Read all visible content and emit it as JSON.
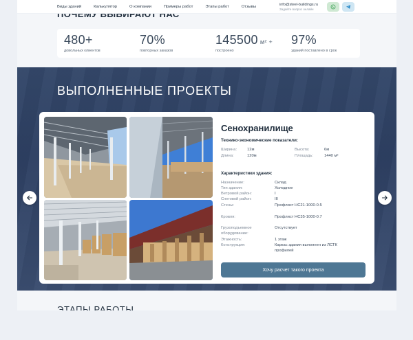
{
  "nav": {
    "items": [
      "Виды зданий",
      "Калькулятор",
      "О компании",
      "Примеры работ",
      "Этапы работ",
      "Отзывы"
    ],
    "email": "info@steel-buildings.ru",
    "email_hint": "Задайте вопрос онлайн",
    "whatsapp_icon": "whatsapp-icon",
    "telegram_icon": "telegram-icon"
  },
  "why": {
    "title": "Почему выбирают нас",
    "stats": [
      {
        "value": "480+",
        "unit": "",
        "label": "довольных клиентов"
      },
      {
        "value": "70%",
        "unit": "",
        "label": "повторных заказов"
      },
      {
        "value": "145500",
        "unit": "м² +",
        "label": "построено"
      },
      {
        "value": "97%",
        "unit": "",
        "label": "зданий поставлено в срок"
      }
    ]
  },
  "projects": {
    "title": "Выполненные проекты",
    "name": "Сенохранилище",
    "tech_heading": "Технико-экономические показатели:",
    "tech": [
      {
        "k": "Ширина:",
        "v": "12м"
      },
      {
        "k": "Длина:",
        "v": "120м"
      },
      {
        "k": "Высота:",
        "v": "6м"
      },
      {
        "k": "Площадь:",
        "v": "1440 м²"
      }
    ],
    "chars_heading": "Характеристики здания:",
    "chars": [
      {
        "k": "Назначение:",
        "v": "Склад"
      },
      {
        "k": "Тип здания:",
        "v": "Холодное"
      },
      {
        "k": "Ветровой район:",
        "v": "I"
      },
      {
        "k": "Снеговой район:",
        "v": "III"
      },
      {
        "k": "Стены:",
        "v": "Профлист НС21-1000-0.5"
      },
      {
        "k": "Кровля:",
        "v": "Профлист НС35-1000-0.7"
      },
      {
        "k": "Грузоподъемное",
        "k2": "оборудование:",
        "v": "Отсутствует"
      },
      {
        "k": "Этажность:",
        "v": "1 этаж"
      },
      {
        "k": "Конструкция:",
        "v": "Каркас здания выполнен из ЛСТК",
        "v2": "профилей"
      }
    ],
    "cta_label": "Хочу расчет такого проекта"
  },
  "stages": {
    "title": "Этапы работы"
  },
  "colors": {
    "accent": "#4e7794",
    "dark_bg": "#2e4063",
    "title_dark": "#1f2d3c"
  }
}
